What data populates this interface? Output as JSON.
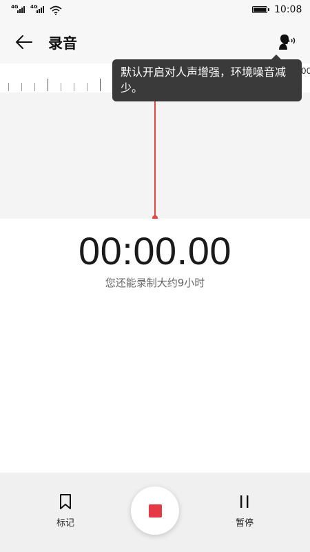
{
  "status_bar": {
    "sim1_label": "4G",
    "sim2_label": "4G",
    "wifi_icon": "wifi-icon",
    "battery_icon": "battery-icon",
    "time": "10:08"
  },
  "app_bar": {
    "back_icon": "arrow-left-icon",
    "title": "录音",
    "voice_icon": "voice-enhance-icon"
  },
  "ruler": {
    "edge_label": "00"
  },
  "tooltip": {
    "text": "默认开启对人声增强，环境噪音减少。"
  },
  "recorder": {
    "elapsed": "00:00.00",
    "remaining_text": "您还能录制大约9小时"
  },
  "bottom_bar": {
    "mark_label": "标记",
    "mark_icon": "bookmark-icon",
    "record_icon": "stop-icon",
    "pause_label": "暂停",
    "pause_icon": "pause-icon"
  },
  "colors": {
    "accent": "#e63946",
    "playhead": "#e64545",
    "tooltip_bg": "#3a3a3a"
  }
}
